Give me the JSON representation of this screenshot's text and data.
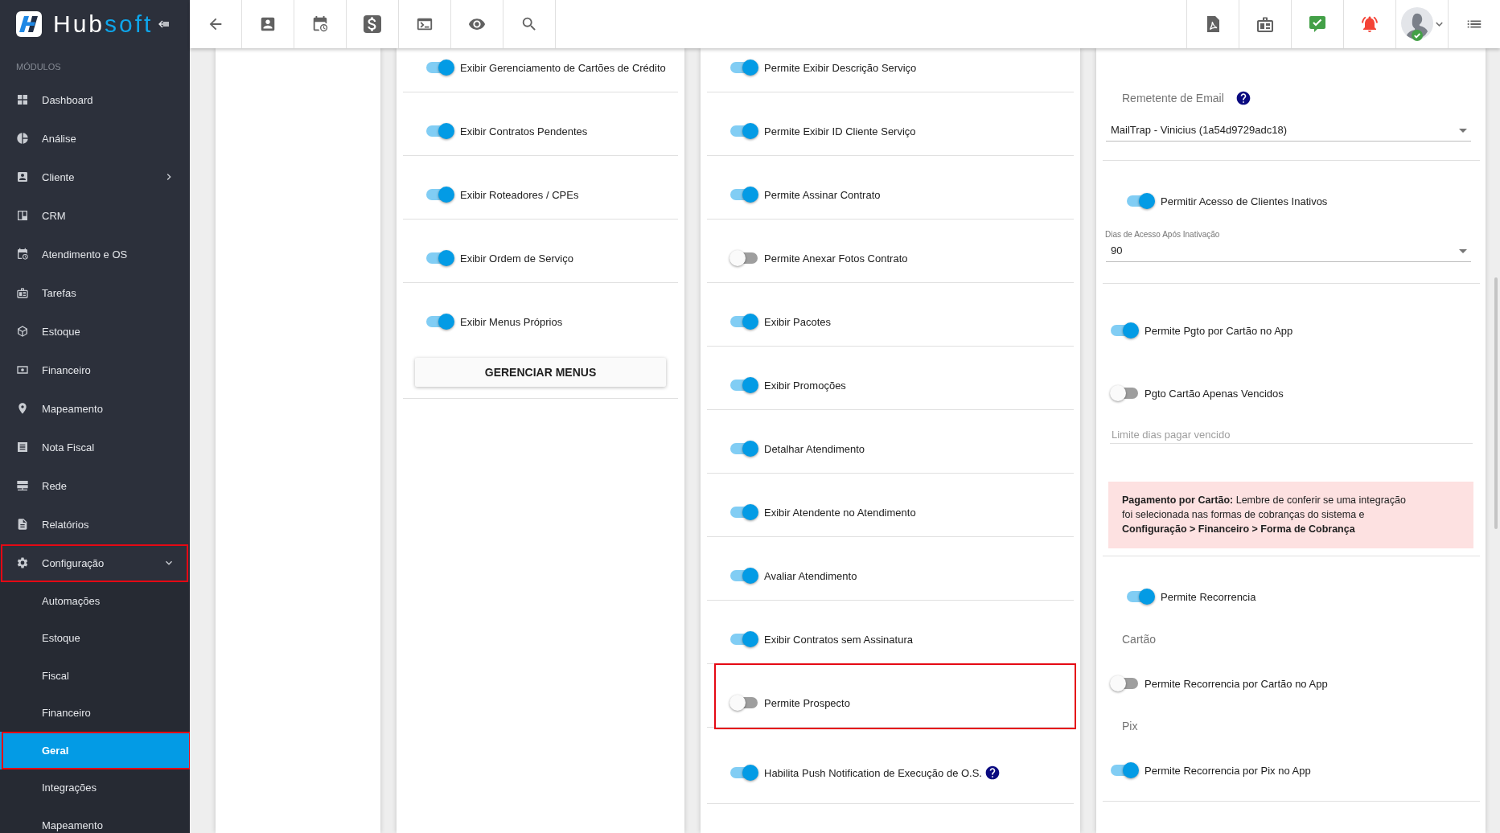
{
  "header": {
    "logo": {
      "text": "Hub",
      "accent": "soft"
    }
  },
  "sidebar": {
    "heading": "MÓDULOS",
    "items": [
      {
        "label": "Dashboard",
        "kind": "link",
        "selected": false,
        "highlighted": false
      },
      {
        "label": "Análise",
        "kind": "link",
        "selected": false,
        "highlighted": false
      },
      {
        "label": "Cliente",
        "kind": "group",
        "expanded": false,
        "selected": false,
        "highlighted": false
      },
      {
        "label": "CRM",
        "kind": "link",
        "selected": false,
        "highlighted": false
      },
      {
        "label": "Atendimento e OS",
        "kind": "link",
        "selected": false,
        "highlighted": false
      },
      {
        "label": "Tarefas",
        "kind": "link",
        "selected": false,
        "highlighted": false
      },
      {
        "label": "Estoque",
        "kind": "link",
        "selected": false,
        "highlighted": false
      },
      {
        "label": "Financeiro",
        "kind": "link",
        "selected": false,
        "highlighted": false
      },
      {
        "label": "Mapeamento",
        "kind": "link",
        "selected": false,
        "highlighted": false
      },
      {
        "label": "Nota Fiscal",
        "kind": "link",
        "selected": false,
        "highlighted": false
      },
      {
        "label": "Rede",
        "kind": "link",
        "selected": false,
        "highlighted": false
      },
      {
        "label": "Relatórios",
        "kind": "link",
        "selected": false,
        "highlighted": false
      },
      {
        "label": "Configuração",
        "kind": "group",
        "expanded": true,
        "selected": false,
        "highlighted": true,
        "children": [
          {
            "label": "Automações",
            "selected": false,
            "highlighted": false
          },
          {
            "label": "Estoque",
            "selected": false,
            "highlighted": false
          },
          {
            "label": "Fiscal",
            "selected": false,
            "highlighted": false
          },
          {
            "label": "Financeiro",
            "selected": false,
            "highlighted": false
          },
          {
            "label": "Geral",
            "selected": true,
            "highlighted": true
          },
          {
            "label": "Integrações",
            "selected": false,
            "highlighted": false
          },
          {
            "label": "Mapeamento",
            "selected": false,
            "highlighted": false
          }
        ]
      }
    ]
  },
  "panels": [
    {
      "kind": "toggle_list",
      "rows": [
        {
          "label": "Exibir Gerenciamento de Cartões de Crédito",
          "on": true,
          "highlighted": false
        },
        {
          "label": "Exibir Contratos Pendentes",
          "on": true,
          "highlighted": false
        },
        {
          "label": "Exibir Roteadores / CPEs",
          "on": true,
          "highlighted": false
        },
        {
          "label": "Exibir Ordem de Serviço",
          "on": true,
          "highlighted": false
        },
        {
          "label": "Exibir Menus Próprios",
          "on": true,
          "highlighted": false,
          "button": "GERENCIAR MENUS"
        }
      ]
    },
    {
      "kind": "toggle_list",
      "rows": [
        {
          "label": "Permite Exibir Descrição Serviço",
          "on": true,
          "highlighted": false
        },
        {
          "label": "Permite Exibir ID Cliente Serviço",
          "on": true,
          "highlighted": false
        },
        {
          "label": "Permite Assinar Contrato",
          "on": true,
          "highlighted": false
        },
        {
          "label": "Permite Anexar Fotos Contrato",
          "on": false,
          "highlighted": false
        },
        {
          "label": "Exibir Pacotes",
          "on": true,
          "highlighted": false
        },
        {
          "label": "Exibir Promoções",
          "on": true,
          "highlighted": false
        },
        {
          "label": "Detalhar Atendimento",
          "on": true,
          "highlighted": false
        },
        {
          "label": "Exibir Atendente no Atendimento",
          "on": true,
          "highlighted": false
        },
        {
          "label": "Avaliar Atendimento",
          "on": true,
          "highlighted": false
        },
        {
          "label": "Exibir Contratos sem Assinatura",
          "on": true,
          "highlighted": false
        },
        {
          "label": "Permite Prospecto",
          "on": false,
          "highlighted": true
        },
        {
          "label": "Habilita Push Notification de Execução de O.S.",
          "on": true,
          "highlighted": false,
          "help": true
        }
      ]
    },
    {
      "kind": "form",
      "sections": [
        {
          "items": [
            {
              "kind": "heading",
              "text": "Remetente de Email",
              "help": true
            },
            {
              "kind": "select",
              "value": "MailTrap - Vinicius (1a54d9729adc18)"
            }
          ]
        },
        {
          "toggle": {
            "label": "Permitir Acesso de Clientes Inativos",
            "on": true
          },
          "items": [
            {
              "kind": "select",
              "label": "Dias de Acesso Após Inativação",
              "value": "90"
            }
          ]
        },
        {
          "items": [
            {
              "kind": "toggle",
              "label": "Permite Pgto por Cartão no App",
              "on": true
            },
            {
              "kind": "toggle",
              "label": "Pgto Cartão Apenas Vencidos",
              "on": false
            },
            {
              "kind": "input",
              "placeholder": "Limite dias pagar vencido"
            },
            {
              "kind": "alert",
              "text": "**Pagamento por Cartão:** Lembre de conferir se uma integração foi selecionada nas formas de cobranças do sistema e **Configuração > Financeiro > Forma de Cobrança**"
            }
          ]
        },
        {
          "toggle": {
            "label": "Permite Recorrencia",
            "on": true
          },
          "items": [
            {
              "kind": "heading",
              "text": "Cartão"
            },
            {
              "kind": "toggle",
              "label": "Permite Recorrencia por Cartão no App",
              "on": false
            },
            {
              "kind": "heading",
              "text": "Pix"
            },
            {
              "kind": "toggle",
              "label": "Permite Recorrencia por Pix no App",
              "on": true
            }
          ]
        }
      ]
    }
  ]
}
